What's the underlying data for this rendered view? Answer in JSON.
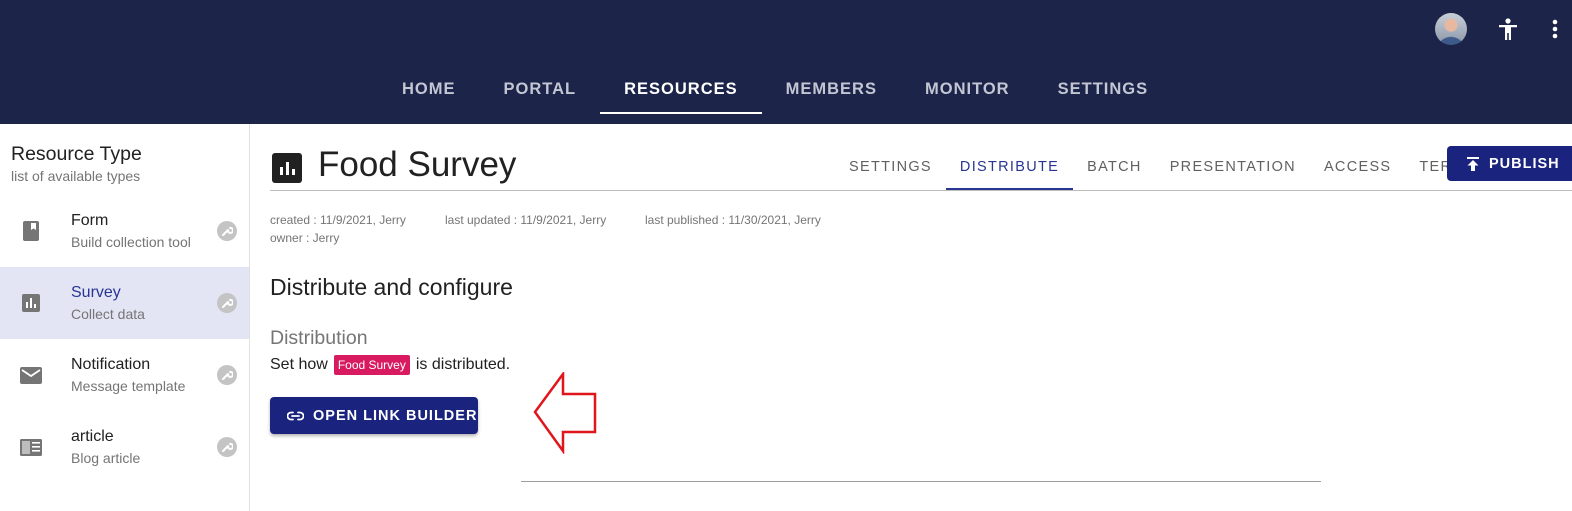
{
  "header": {
    "nav": [
      {
        "label": "HOME",
        "active": false
      },
      {
        "label": "PORTAL",
        "active": false
      },
      {
        "label": "RESOURCES",
        "active": true
      },
      {
        "label": "MEMBERS",
        "active": false
      },
      {
        "label": "MONITOR",
        "active": false
      },
      {
        "label": "SETTINGS",
        "active": false
      }
    ],
    "icons": [
      "avatar",
      "accessibility-icon",
      "more-vert-icon"
    ],
    "colors": {
      "bar": "#1d2449",
      "active_text": "#ffffff"
    }
  },
  "sidebar": {
    "title": "Resource Type",
    "subtitle": "list of available types",
    "items": [
      {
        "name": "Form",
        "desc": "Build collection tool",
        "icon": "book-icon",
        "active": false
      },
      {
        "name": "Survey",
        "desc": "Collect data",
        "icon": "poll-icon",
        "active": true
      },
      {
        "name": "Notification",
        "desc": "Message template",
        "icon": "mail-icon",
        "active": false
      },
      {
        "name": "article",
        "desc": "Blog article",
        "icon": "article-icon",
        "active": false
      }
    ]
  },
  "main": {
    "title": "Food Survey",
    "tabs": [
      {
        "label": "SETTINGS",
        "active": false
      },
      {
        "label": "DISTRIBUTE",
        "active": true
      },
      {
        "label": "BATCH",
        "active": false
      },
      {
        "label": "PRESENTATION",
        "active": false
      },
      {
        "label": "ACCESS",
        "active": false
      },
      {
        "label": "TERMS",
        "active": false
      }
    ],
    "publish_label": "PUBLISH",
    "meta": {
      "created": "created : 11/9/2021, Jerry",
      "updated": "last updated : 11/9/2021, Jerry",
      "published": "last published : 11/30/2021, Jerry",
      "owner": "owner : Jerry"
    },
    "section_title": "Distribute and configure",
    "distribution": {
      "title": "Distribution",
      "text_before": "Set how",
      "chip": "Food Survey",
      "text_after": "is distributed."
    },
    "link_builder_label": "OPEN LINK BUILDER",
    "colors": {
      "primary": "#1a237e",
      "chip": "#d81b60",
      "annotation_arrow": "#e0161c"
    }
  }
}
